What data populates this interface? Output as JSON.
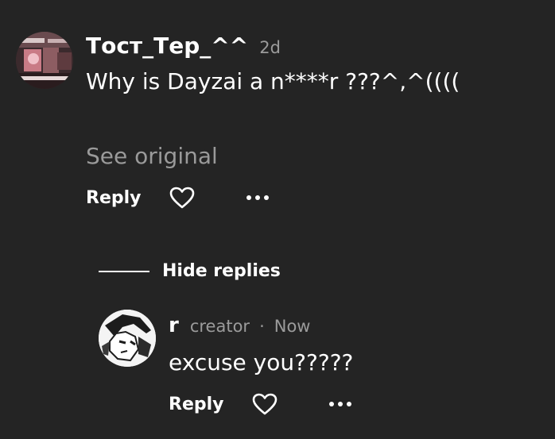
{
  "comment": {
    "username": "Тост_Тер_^^",
    "time": "2d",
    "text": "Why is Dayzai a n****r ???^,^((((",
    "see_original": "See original",
    "actions": {
      "reply_label": "Reply",
      "like_icon": "heart-outline-icon",
      "more_icon": "more-horizontal-icon"
    }
  },
  "hide_replies": {
    "label": "Hide replies"
  },
  "reply": {
    "username": "r",
    "badge": "creator",
    "separator": "·",
    "time": "Now",
    "text": "excuse you?????",
    "actions": {
      "reply_label": "Reply",
      "like_icon": "heart-outline-icon",
      "more_icon": "more-horizontal-icon"
    }
  },
  "colors": {
    "background": "#242424",
    "primary_text": "#ffffff",
    "secondary_text": "#9b9b9b"
  }
}
